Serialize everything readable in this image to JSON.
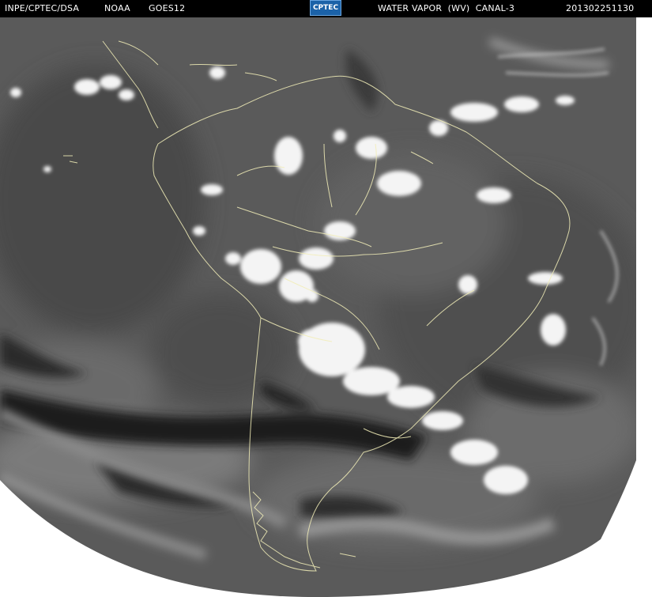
{
  "header": {
    "source": "INPE/CPTEC/DSA",
    "agency": "NOAA",
    "satellite": "GOES12",
    "logo_text": "CPTEC",
    "product": "WATER VAPOR  (WV)  CANAL-3",
    "timestamp": "201302251130"
  },
  "colors": {
    "header_bg": "#000000",
    "header_text": "#ffffff",
    "logo_bg": "#1b62a8",
    "coastline": "#f2eeb8",
    "cloud": "#f4f4f4",
    "moist": "#777777",
    "dry": "#1c1c1c"
  }
}
